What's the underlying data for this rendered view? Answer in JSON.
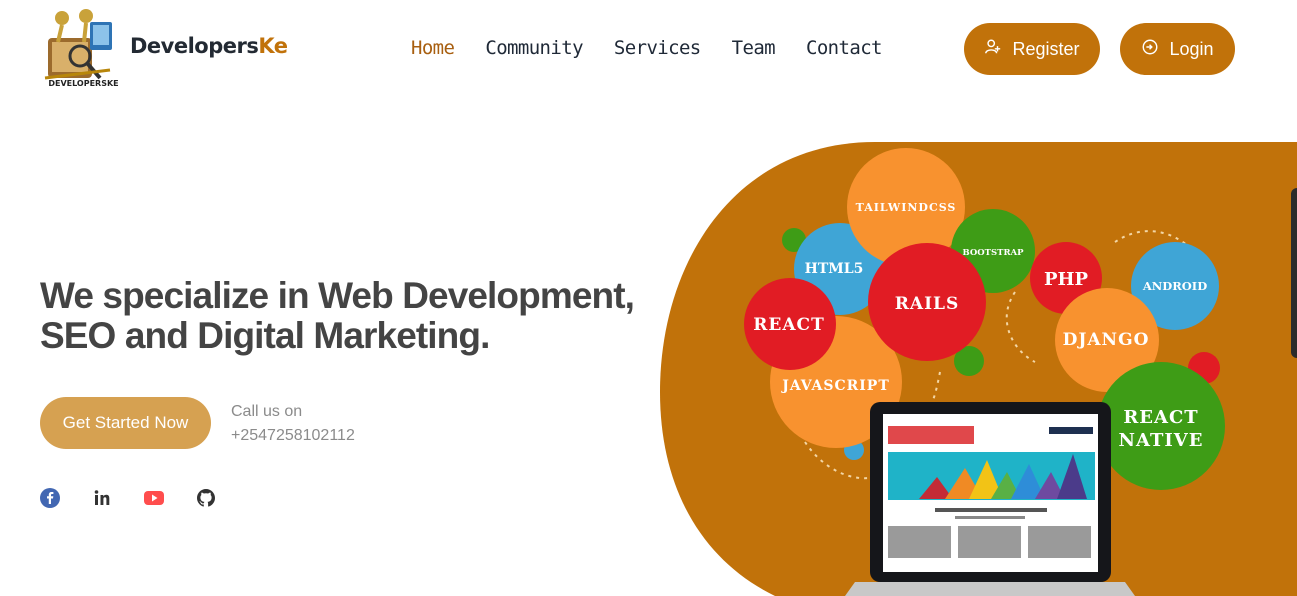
{
  "brand": {
    "logo_caption": "DEVELOPERSKE",
    "name_part1": "Developers",
    "name_part2": "Ke",
    "accent_color": "#c1720a"
  },
  "nav": {
    "items": [
      {
        "label": "Home",
        "active": true
      },
      {
        "label": "Community",
        "active": false
      },
      {
        "label": "Services",
        "active": false
      },
      {
        "label": "Team",
        "active": false
      },
      {
        "label": "Contact",
        "active": false
      }
    ]
  },
  "auth": {
    "register_label": "Register",
    "register_icon": "user-plus-icon",
    "login_label": "Login",
    "login_icon": "login-icon"
  },
  "hero": {
    "headline_line1": "We specialize in Web Development,",
    "headline_line2": "SEO and Digital Marketing.",
    "cta_label": "Get Started Now",
    "call_label": "Call us on",
    "phone": "+2547258102112",
    "cta_color": "#d6a151",
    "background_color": "#c1720a"
  },
  "socials": [
    {
      "name": "facebook-icon",
      "color": "#4267b2"
    },
    {
      "name": "linkedin-icon",
      "color": "#333333"
    },
    {
      "name": "youtube-icon",
      "color": "#ff4d4d"
    },
    {
      "name": "github-icon",
      "color": "#333333"
    }
  ],
  "tech_bubbles": [
    {
      "label": "TAILWINDCSS",
      "color": "#f8922f"
    },
    {
      "label": "BOOTSTRAP",
      "color": "#3e9c16"
    },
    {
      "label": "HTML5",
      "color": "#3fa5d6"
    },
    {
      "label": "RAILS",
      "color": "#e11c24"
    },
    {
      "label": "PHP",
      "color": "#e11c24"
    },
    {
      "label": "ANDROID",
      "color": "#3fa5d6"
    },
    {
      "label": "REACT",
      "color": "#e11c24"
    },
    {
      "label": "DJANGO",
      "color": "#f8922f"
    },
    {
      "label": "JAVASCRIPT",
      "color": "#f8922f"
    },
    {
      "label": "REACT",
      "color": "#3e9c16"
    },
    {
      "label": "NATIVE",
      "color": "#3e9c16"
    }
  ]
}
